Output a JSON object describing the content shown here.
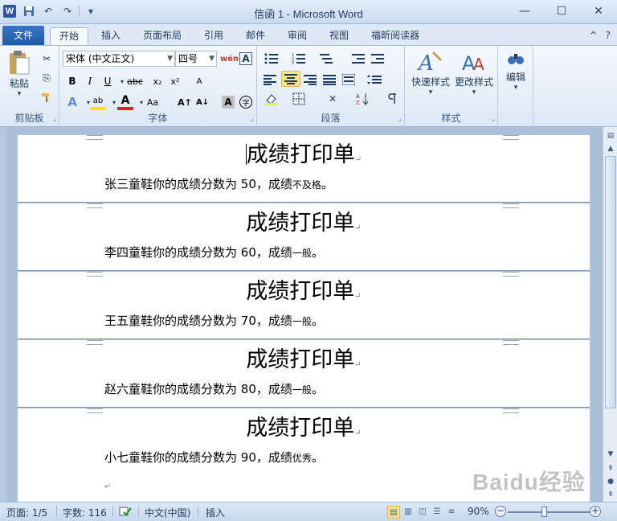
{
  "window": {
    "title": "信函 1 - Microsoft Word",
    "app_icon_letter": "W",
    "controls": {
      "minimize": "—",
      "maximize": "☐",
      "close": "✕"
    }
  },
  "qat": {
    "save_icon": "💾",
    "undo_icon": "↶",
    "redo_icon": "↷",
    "customize_icon": "▾"
  },
  "tabs": {
    "file": "文件",
    "items": [
      "开始",
      "插入",
      "页面布局",
      "引用",
      "邮件",
      "审阅",
      "视图",
      "福昕阅读器"
    ],
    "active": "开始",
    "help_icon": "?",
    "collapse_icon": "^"
  },
  "ribbon": {
    "clipboard": {
      "label": "剪贴板",
      "paste": "粘贴",
      "cut_icon": "✂",
      "copy_icon": "⎘",
      "format_painter_icon": "🖌"
    },
    "font": {
      "label": "字体",
      "font_name": "宋体 (中文正文)",
      "font_size": "四号",
      "bold": "B",
      "italic": "I",
      "underline": "U",
      "strike": "abc",
      "subscript": "x₂",
      "superscript": "x²",
      "grow": "A↑",
      "shrink": "A↓",
      "change_case": "Aa",
      "phonetic": "wén",
      "char_border": "A",
      "clear_format": "A",
      "highlight": "ab",
      "font_color": "A",
      "shading": "A",
      "enclose": "字"
    },
    "paragraph": {
      "label": "段落"
    },
    "styles": {
      "label": "样式",
      "quick_styles": "快速样式",
      "change_styles": "更改样式"
    },
    "editing": {
      "label": "编辑",
      "icon": "🔍"
    }
  },
  "document": {
    "pages": [
      {
        "title": "成绩打印单",
        "text_main": "张三童鞋你的成绩分数为 50，成绩",
        "text_small": "不及格",
        "end": "。"
      },
      {
        "title": "成绩打印单",
        "text_main": "李四童鞋你的成绩分数为 60，成绩",
        "text_small": "一般",
        "end": "。"
      },
      {
        "title": "成绩打印单",
        "text_main": "王五童鞋你的成绩分数为 70，成绩",
        "text_small": "一般",
        "end": "。"
      },
      {
        "title": "成绩打印单",
        "text_main": "赵六童鞋你的成绩分数为 80，成绩",
        "text_small": "一般",
        "end": "。"
      },
      {
        "title": "成绩打印单",
        "text_main": "小七童鞋你的成绩分数为 90，成绩",
        "text_small": "优秀",
        "end": "。"
      }
    ],
    "paragraph_mark": "↵"
  },
  "statusbar": {
    "page": "页面: 1/5",
    "words": "字数: 116",
    "language": "中文(中国)",
    "mode": "插入",
    "zoom": "90%",
    "zoom_level": 0.9
  },
  "watermark": "Baidu经验"
}
